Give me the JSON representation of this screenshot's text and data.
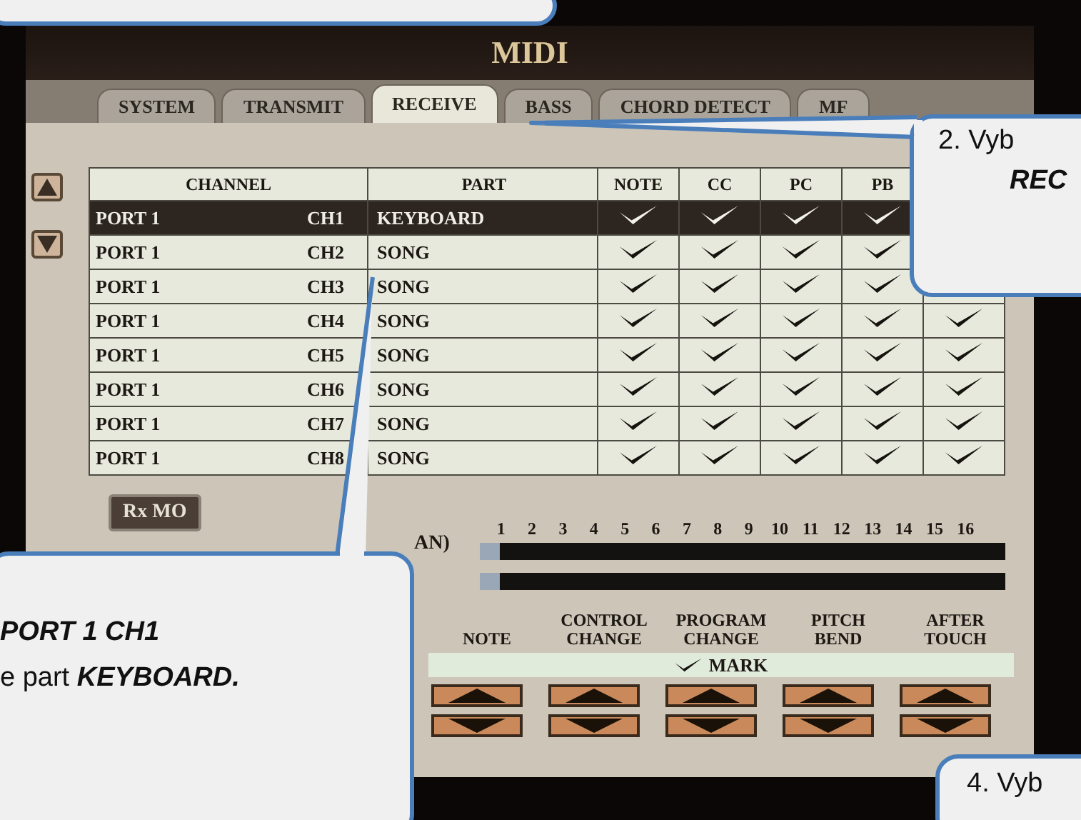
{
  "screen": {
    "title": "MIDI",
    "tabs": [
      {
        "label": "SYSTEM",
        "selected": false
      },
      {
        "label": "TRANSMIT",
        "selected": false
      },
      {
        "label": "RECEIVE",
        "selected": true
      },
      {
        "label": "BASS",
        "selected": false
      },
      {
        "label": "CHORD DETECT",
        "selected": false
      },
      {
        "label": "MF",
        "selected": false
      }
    ],
    "table": {
      "columns": [
        "CHANNEL",
        "PART",
        "NOTE",
        "CC",
        "PC",
        "PB"
      ],
      "rows": [
        {
          "port": "PORT 1",
          "channel": "CH1",
          "part": "KEYBOARD",
          "selected": true,
          "checks": [
            true,
            true,
            true,
            true
          ]
        },
        {
          "port": "PORT 1",
          "channel": "CH2",
          "part": "SONG",
          "selected": false,
          "checks": [
            true,
            true,
            true,
            true
          ]
        },
        {
          "port": "PORT 1",
          "channel": "CH3",
          "part": "SONG",
          "selected": false,
          "checks": [
            true,
            true,
            true,
            true
          ]
        },
        {
          "port": "PORT 1",
          "channel": "CH4",
          "part": "SONG",
          "selected": false,
          "checks": [
            true,
            true,
            true,
            true,
            true
          ]
        },
        {
          "port": "PORT 1",
          "channel": "CH5",
          "part": "SONG",
          "selected": false,
          "checks": [
            true,
            true,
            true,
            true,
            true
          ]
        },
        {
          "port": "PORT 1",
          "channel": "CH6",
          "part": "SONG",
          "selected": false,
          "checks": [
            true,
            true,
            true,
            true,
            true
          ]
        },
        {
          "port": "PORT 1",
          "channel": "CH7",
          "part": "SONG",
          "selected": false,
          "checks": [
            true,
            true,
            true,
            true,
            true
          ]
        },
        {
          "port": "PORT 1",
          "channel": "CH8",
          "part": "SONG",
          "selected": false,
          "checks": [
            true,
            true,
            true,
            true,
            true
          ]
        }
      ]
    },
    "rx_button": "Rx MO",
    "meter_label": "AN)",
    "channel_numbers": [
      "1",
      "2",
      "3",
      "4",
      "5",
      "6",
      "7",
      "8",
      "9",
      "10",
      "11",
      "12",
      "13",
      "14",
      "15",
      "16"
    ],
    "message_types": [
      [
        "NOTE"
      ],
      [
        "CONTROL",
        "CHANGE"
      ],
      [
        "PROGRAM",
        "CHANGE"
      ],
      [
        "PITCH",
        "BEND"
      ],
      [
        "AFTER",
        "TOUCH"
      ]
    ],
    "mark_legend": "MARK"
  },
  "callouts": [
    {
      "kind": "top"
    },
    {
      "kind": "tab",
      "lines": [
        "2. Vyb",
        "REC"
      ]
    },
    {
      "kind": "row",
      "lines": [
        "PORT 1 CH1",
        "e part **KEYBOARD.**"
      ]
    },
    {
      "kind": "bottom",
      "lines": [
        "4. Vyb"
      ]
    }
  ]
}
